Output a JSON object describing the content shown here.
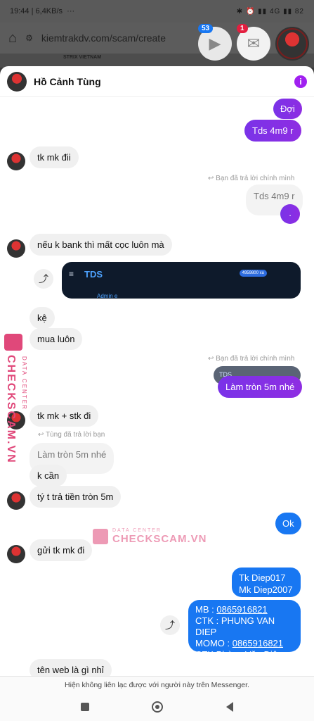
{
  "status": {
    "time": "19:44",
    "speed": "6,4KB/s",
    "dots": "···",
    "right": "✱ ⏰ ▮▮ 4G ▮▮ 82"
  },
  "browser": {
    "url": "kiemtrakdv.com/scam/create",
    "page_title": "STRIX VIETNAM"
  },
  "chat_heads": {
    "video_badge": "53",
    "messenger_badge": "1"
  },
  "header": {
    "name": "Hồ Cảnh Tùng",
    "info": "i"
  },
  "messages": {
    "out_doi": "Đợi",
    "out_tds1": "Tds 4m9 r",
    "in_tkmk": "tk mk đii",
    "reply_self1": "↩ Bạn đã trả lời chính mình",
    "quoted_tds": "Tds 4m9 r",
    "out_dot": ".",
    "in_bank": "nếu k bank thì mất cọc luôn mà",
    "tds_logo": "TDS",
    "tds_balance": "4959800 xu",
    "tds_sub": "Admin e",
    "in_ke": "kệ",
    "in_mua": "mua luôn",
    "reply_self2": "↩ Bạn đã trả lời chính mình",
    "quoted_tds_img": "TDS",
    "out_lamtron": "Làm tròn 5m nhé",
    "in_stk": "tk mk + stk đi",
    "reply_tung": "↩ Tùng đã trả lời bạn",
    "quoted_lamtron": "Làm tròn 5m nhé",
    "in_kcan": "k cần",
    "in_tyt": "tý t trả tiền tròn 5m",
    "out_ok": "Ok",
    "in_gui": "gửi tk mk đi",
    "out_tk1": "Tk Diep017",
    "out_tk2": "Mk Diep2007",
    "pay_mb_label": "MB : ",
    "pay_mb": "0865916821",
    "pay_ctk": "CTK : PHUNG VAN DIEP",
    "pay_momo_label": "MOMO : ",
    "pay_momo": "0865916821",
    "pay_ctk2": "CTK Phùng Văn Điệp",
    "in_tenweb": "tên web là gì nhỉ"
  },
  "watermark": {
    "side_text": "CHECKSCAM.VN",
    "side_sub": "DATA CENTER",
    "mid_sub": "DATA CENTER",
    "mid_text": "CHECKSCAM.VN"
  },
  "footer_note": "Hiện không liên lạc được với người này trên Messenger."
}
